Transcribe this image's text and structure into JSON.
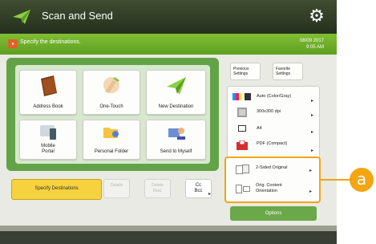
{
  "window": {
    "title": "Scan and Send"
  },
  "info": {
    "message": "Specify the destinations.",
    "date": "08/09 2017",
    "time": "9:05 AM"
  },
  "destinations": [
    {
      "label": "Address Book",
      "icon": "address-book-icon"
    },
    {
      "label": "One-Touch",
      "icon": "one-touch-icon"
    },
    {
      "label": "New Destination",
      "icon": "new-destination-icon"
    },
    {
      "label": "Mobile\nPortal",
      "icon": "mobile-portal-icon"
    },
    {
      "label": "Personal Folder",
      "icon": "personal-folder-icon"
    },
    {
      "label": "Send to Myself",
      "icon": "send-to-myself-icon"
    }
  ],
  "bottom_buttons": {
    "specify": "Specify Destinations",
    "details": "Details",
    "delete": "Delete\nDest.",
    "cc": "Cc\nBcc"
  },
  "top_buttons": {
    "previous": "Previous\nSettings",
    "favorite": "Favorite\nSettings"
  },
  "settings": {
    "color": "Auto (Color/Gray)",
    "resolution": "300x300 dpi",
    "size": "A4",
    "format": "PDF (Compact)"
  },
  "extra": {
    "two_sided": "2-Sided Original",
    "orientation": "Orig. Content\nOrientation"
  },
  "options": "Options",
  "callout": "a",
  "colors": {
    "accent": "#f3a512",
    "green": "#63a347",
    "titlebar": "#2f3a25"
  }
}
